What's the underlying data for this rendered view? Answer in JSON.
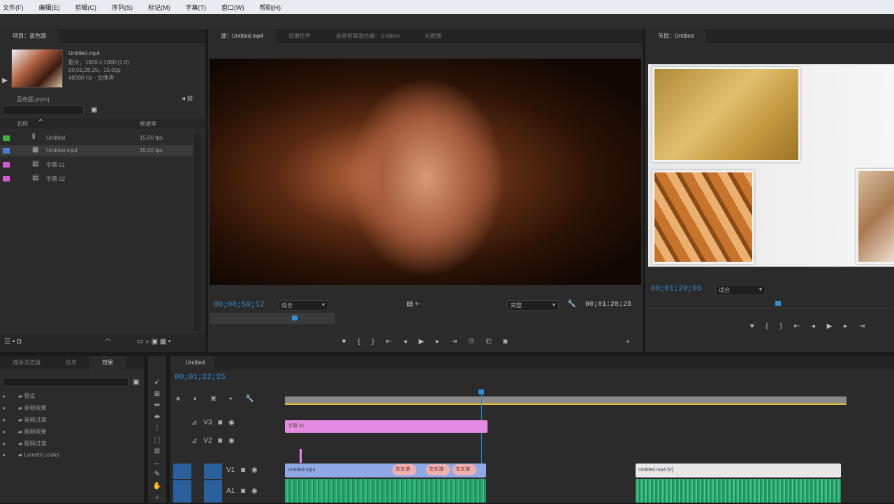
{
  "menubar": {
    "items": [
      "文件(F)",
      "编辑(E)",
      "剪辑(C)",
      "序列(S)",
      "标记(M)",
      "字幕(T)",
      "窗口(W)",
      "帮助(H)"
    ]
  },
  "project": {
    "tabs": [
      "项目：蓝色圆"
    ],
    "clip_name": "Untitled.mp4",
    "clip_info1": "影片，1920 x 1080 (1.0)",
    "clip_info2": "00;01;28;25，15.00p",
    "clip_info3": "48000 Hz - 立体声",
    "project_file": "蓝色圆.prproj",
    "col_name": "名称",
    "col_fps": "帧速率",
    "items": [
      {
        "name": "Untitled",
        "fps": "15.00 fps",
        "color": "#3fb33f"
      },
      {
        "name": "Untitled.mp4",
        "fps": "15.00 fps",
        "color": "#4a7fd0"
      },
      {
        "name": "字幕 01",
        "fps": "",
        "color": "#d05ad0"
      },
      {
        "name": "字幕 02",
        "fps": "",
        "color": "#d05ad0"
      }
    ]
  },
  "source": {
    "tabs": [
      "源：Untitled.mp4",
      "效果控件",
      "音频剪辑混合器：Untitled",
      "元数据"
    ],
    "timecode": "00;00;59;12",
    "fit": "适合",
    "quality": "完整",
    "duration": "00;01;28;25"
  },
  "program": {
    "tab": "节目：Untitled",
    "timecode": "00;01;20;05",
    "fit": "适合"
  },
  "effects": {
    "tabs": [
      "媒体浏览器",
      "信息",
      "效果"
    ],
    "items": [
      "预设",
      "音频效果",
      "音频过渡",
      "视频效果",
      "视频过渡",
      "Lumetri Looks"
    ]
  },
  "timeline": {
    "tab": "Untitled",
    "timecode": "00;01;22;25",
    "tracks": [
      "V3",
      "V2",
      "V1",
      "A1"
    ],
    "title_clip": "字幕 01",
    "v1_clip": "Untitled.mp4",
    "v1_clip2": "Untitled.mp4 [V]",
    "fx_label": "交叉溶",
    "playhead_fraction": 0.35
  },
  "colors": {
    "accent": "#2f8fd8",
    "title_clip": "#e58ae3",
    "video_clip": "#8fa8e6",
    "audio_clip": "#2aa36d"
  }
}
